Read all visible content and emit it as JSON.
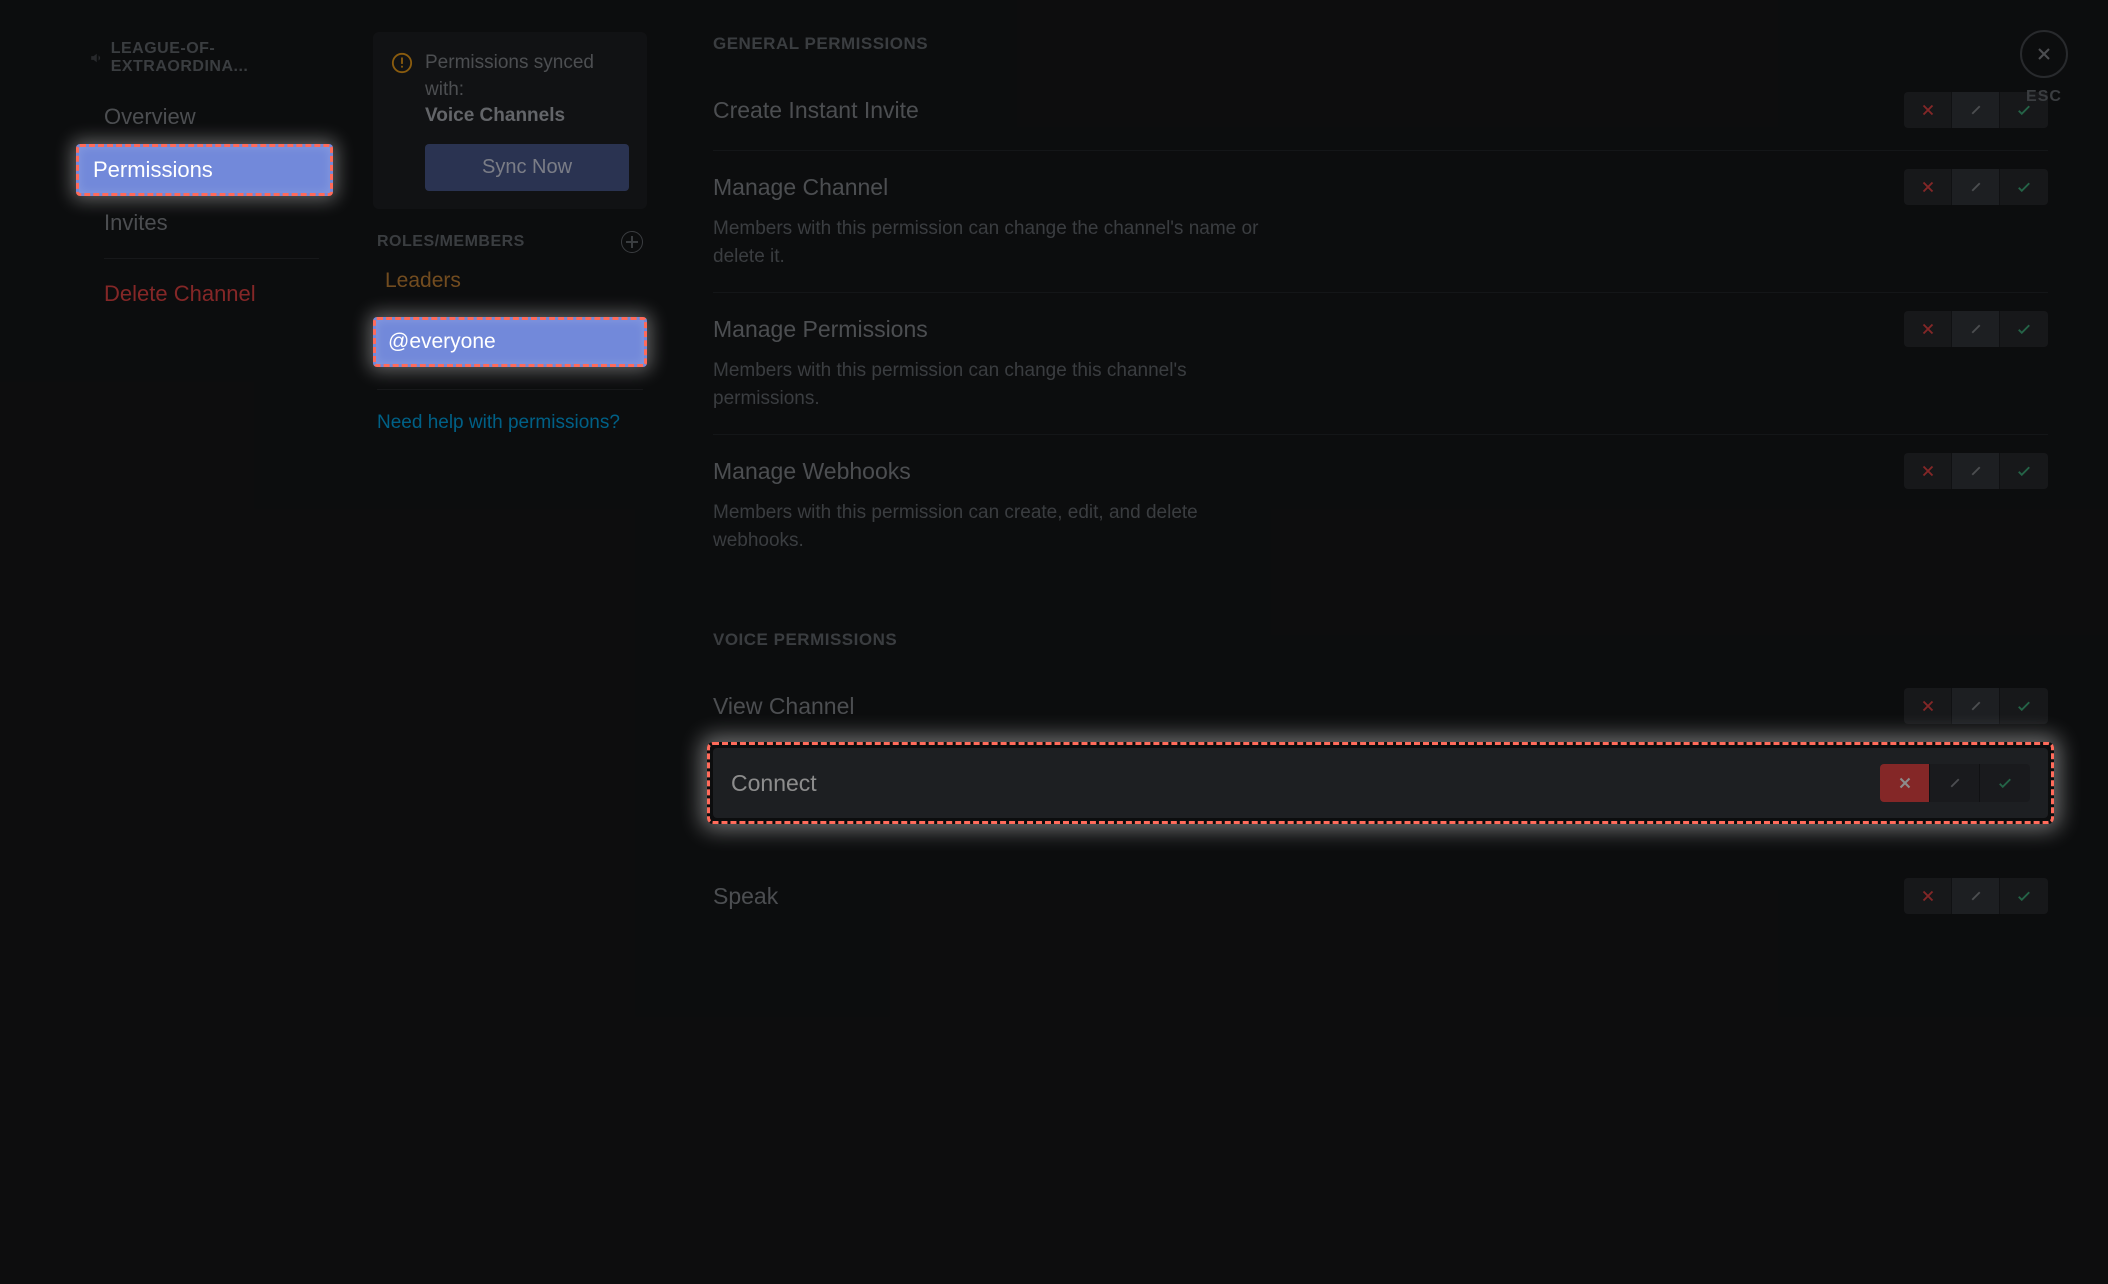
{
  "sidebar": {
    "channel_name": "LEAGUE-OF-EXTRAORDINA...",
    "items": {
      "overview": "Overview",
      "permissions": "Permissions",
      "invites": "Invites",
      "delete": "Delete Channel"
    }
  },
  "sync": {
    "prefix": "Permissions synced with:",
    "category": "Voice Channels",
    "button": "Sync Now"
  },
  "roles": {
    "header": "ROLES/MEMBERS",
    "leaders": "Leaders",
    "everyone": "@everyone"
  },
  "help_link": "Need help with permissions?",
  "sections": {
    "general": "GENERAL PERMISSIONS",
    "voice": "VOICE PERMISSIONS"
  },
  "perms": {
    "create_invite": {
      "name": "Create Instant Invite"
    },
    "manage_channel": {
      "name": "Manage Channel",
      "desc": "Members with this permission can change the channel's name or delete it."
    },
    "manage_permissions": {
      "name": "Manage Permissions",
      "desc": "Members with this permission can change this channel's permissions."
    },
    "manage_webhooks": {
      "name": "Manage Webhooks",
      "desc": "Members with this permission can create, edit, and delete webhooks."
    },
    "view_channel": {
      "name": "View Channel"
    },
    "connect": {
      "name": "Connect"
    },
    "speak": {
      "name": "Speak"
    }
  },
  "esc": "ESC"
}
